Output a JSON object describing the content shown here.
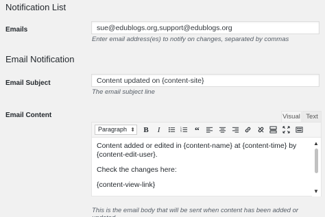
{
  "sections": {
    "notification_list": "Notification List",
    "email_notification": "Email Notification"
  },
  "emails": {
    "label": "Emails",
    "value": "sue@edublogs.org,support@edublogs.org",
    "description": "Enter email address(es) to notify on changes, separated by commas"
  },
  "subject": {
    "label": "Email Subject",
    "value": "Content updated on {content-site}",
    "description": "The email subject line"
  },
  "content": {
    "label": "Email Content",
    "tabs": {
      "visual": "Visual",
      "text": "Text"
    },
    "format_select": "Paragraph",
    "paragraphs": [
      "Content added or edited in {content-name} at {content-time} by {content-edit-user}.",
      "Check the changes here:",
      "{content-view-link}"
    ],
    "description": "This is the email body that will be sent when content has been added or updated."
  },
  "toolbar_icons": [
    "bold-icon",
    "italic-icon",
    "bullet-list-icon",
    "numbered-list-icon",
    "blockquote-icon",
    "align-left-icon",
    "align-center-icon",
    "align-right-icon",
    "link-icon",
    "unlink-icon",
    "read-more-icon",
    "fullscreen-icon",
    "toolbar-toggle-icon"
  ]
}
